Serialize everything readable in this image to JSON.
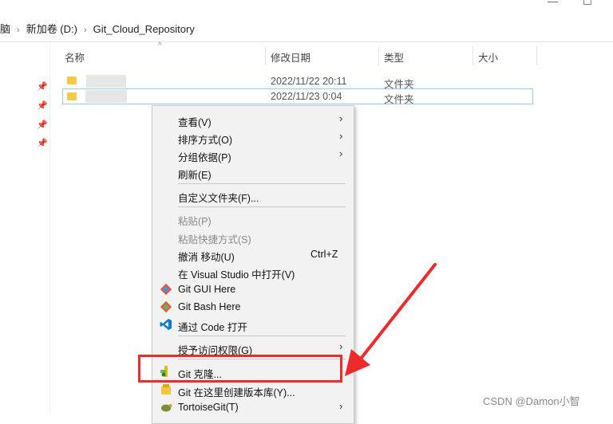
{
  "window": {
    "minimize_glyph": "—",
    "maximize_glyph": "☐"
  },
  "breadcrumb": {
    "partial_prev": "脑",
    "drive": "新加卷 (D:)",
    "folder": "Git_Cloud_Repository",
    "separator": "›"
  },
  "columns": {
    "name": "名称",
    "modified": "修改日期",
    "type": "类型",
    "size": "大小"
  },
  "files": [
    {
      "modified": "2022/11/22 20:11",
      "type": "文件夹"
    },
    {
      "modified": "2022/11/23 0:04",
      "type": "文件夹"
    }
  ],
  "context_menu": {
    "view": "查看(V)",
    "sort": "排序方式(O)",
    "group": "分组依据(P)",
    "refresh": "刷新(E)",
    "customize": "自定义文件夹(F)...",
    "paste": "粘贴(P)",
    "paste_shortcut": "粘贴快捷方式(S)",
    "undo_move": "撤消 移动(U)",
    "undo_shortcut": "Ctrl+Z",
    "open_vs": "在 Visual Studio 中打开(V)",
    "git_gui": "Git GUI Here",
    "git_bash": "Git Bash Here",
    "open_code": "通过 Code 打开",
    "grant_access": "授予访问权限(G)",
    "git_clone": "Git 克隆...",
    "git_create_repo": "Git 在这里创建版本库(Y)...",
    "tortoisegit": "TortoiseGit(T)"
  },
  "colors": {
    "highlight": "#ee2b2b",
    "selection_border": "#99c9ef",
    "menu_bg": "#f2f2f2"
  },
  "watermark": "CSDN @Damon小智"
}
